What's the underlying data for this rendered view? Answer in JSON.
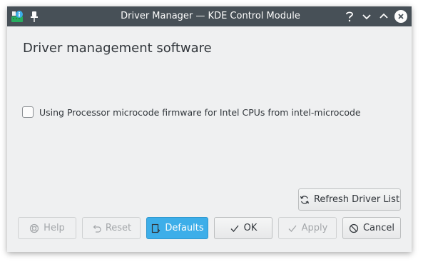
{
  "titlebar": {
    "title": "Driver Manager — KDE Control Module",
    "icons": [
      "app-icon",
      "pin-icon",
      "help-icon",
      "minimize-icon",
      "maximize-icon",
      "close-icon"
    ]
  },
  "main": {
    "heading": "Driver management software",
    "driver_option": {
      "label": "Using Processor microcode firmware for Intel CPUs from intel-microcode",
      "checked": false
    }
  },
  "buttons": {
    "refresh": "Refresh Driver List",
    "help": "Help",
    "reset": "Reset",
    "defaults": "Defaults",
    "ok": "OK",
    "apply": "Apply",
    "cancel": "Cancel"
  },
  "colors": {
    "titlebar": "#475057",
    "window_bg": "#eff0f1",
    "accent": "#3daee9"
  }
}
